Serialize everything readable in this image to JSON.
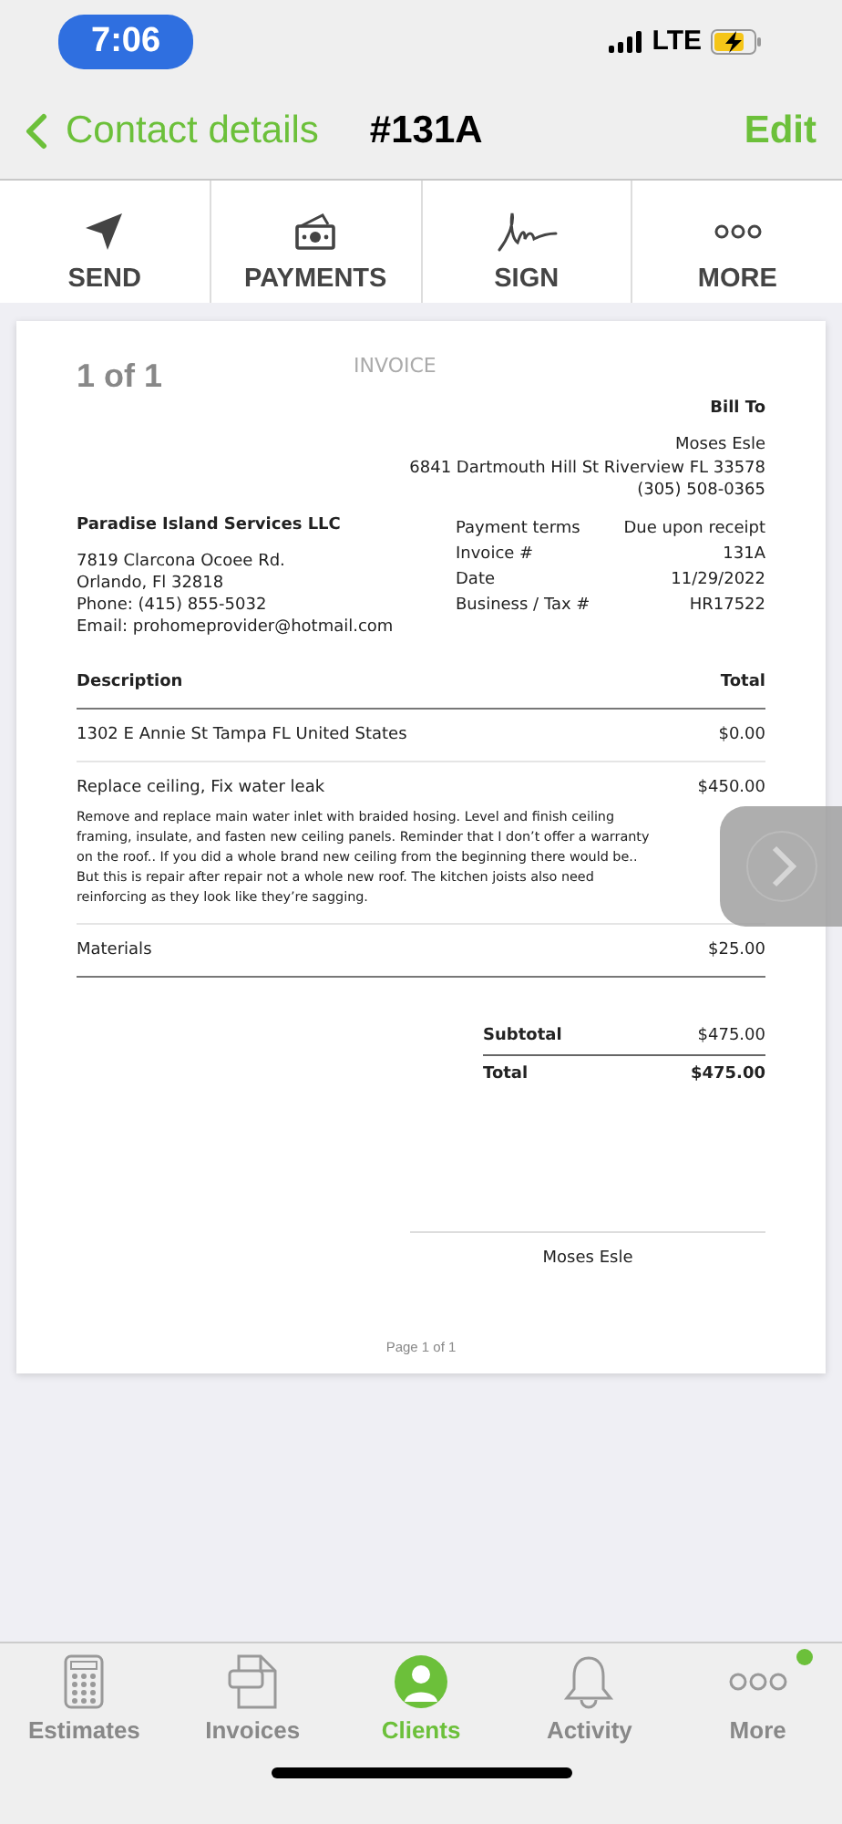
{
  "status_bar": {
    "time": "7:06",
    "network": "LTE"
  },
  "nav": {
    "back": "Contact details",
    "title": "#131A",
    "action": "Edit"
  },
  "actions": [
    {
      "kind": "send",
      "label": "SEND"
    },
    {
      "kind": "payments",
      "label": "PAYMENTS"
    },
    {
      "kind": "sign",
      "label": "SIGN"
    },
    {
      "kind": "more",
      "label": "MORE"
    }
  ],
  "invoice": {
    "page_count": "1 of 1",
    "heading": "INVOICE",
    "bill_to_label": "Bill To",
    "bill_to": [
      "Moses Esle",
      "6841 Dartmouth Hill St Riverview FL 33578",
      "(305) 508-0365"
    ],
    "company": "Paradise Island Services LLC",
    "company_lines": [
      "7819 Clarcona Ocoee Rd.",
      "Orlando, Fl 32818",
      "Phone: (415) 855-5032",
      "Email: prohomeprovider@hotmail.com"
    ],
    "details": [
      {
        "label": "Payment terms",
        "value": "Due upon receipt"
      },
      {
        "label": "Invoice #",
        "value": "131A"
      },
      {
        "label": "Date",
        "value": "11/29/2022"
      },
      {
        "label": "Business / Tax #",
        "value": "HR17522"
      }
    ],
    "columns": [
      "Description",
      "Total"
    ],
    "items": [
      {
        "description": "1302 E Annie St Tampa FL United States",
        "total": "$0.00"
      },
      {
        "description": "Replace ceiling, Fix water leak",
        "total": "$450.00",
        "note": "Remove and replace main water inlet with braided hosing. Level  and finish ceiling framing, insulate, and fasten new ceiling panels. Reminder that I don’t offer a warranty on the roof.. If you did a whole brand new ceiling from the beginning there would be.. But this is repair after repair not a whole new roof. The kitchen joists also need reinforcing as they look like they’re sagging."
      },
      {
        "description": "Materials",
        "total": "$25.00"
      }
    ],
    "subtotal_label": "Subtotal",
    "subtotal": "$475.00",
    "total_label": "Total",
    "total": "$475.00",
    "signature_name": "Moses Esle",
    "footer": "Page 1 of 1"
  },
  "tabs": [
    {
      "kind": "estimates",
      "label": "Estimates",
      "selected": false,
      "badge": false
    },
    {
      "kind": "invoices",
      "label": "Invoices",
      "selected": false,
      "badge": false
    },
    {
      "kind": "clients",
      "label": "Clients",
      "selected": true,
      "badge": false
    },
    {
      "kind": "activity",
      "label": "Activity",
      "selected": false,
      "badge": false
    },
    {
      "kind": "more",
      "label": "More",
      "selected": false,
      "badge": true
    }
  ]
}
